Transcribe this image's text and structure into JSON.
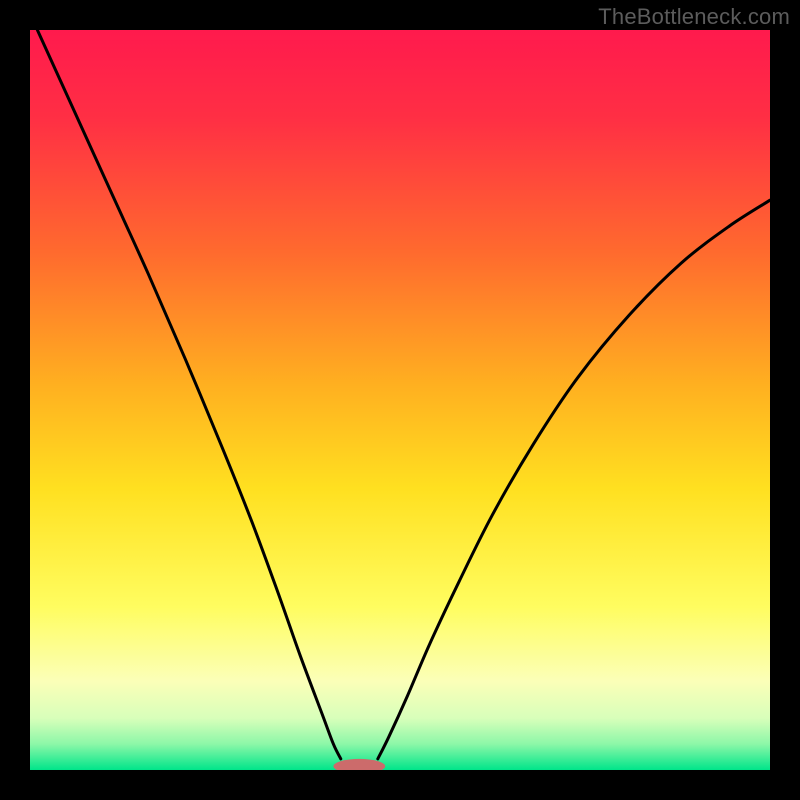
{
  "watermark": "TheBottleneck.com",
  "chart_data": {
    "type": "line",
    "title": "",
    "xlabel": "",
    "ylabel": "",
    "xlim": [
      0,
      1
    ],
    "ylim": [
      0,
      1
    ],
    "background_gradient": {
      "stops": [
        {
          "offset": 0.0,
          "color": "#ff1a4d"
        },
        {
          "offset": 0.12,
          "color": "#ff2f44"
        },
        {
          "offset": 0.3,
          "color": "#ff6a2e"
        },
        {
          "offset": 0.48,
          "color": "#ffb020"
        },
        {
          "offset": 0.62,
          "color": "#ffe020"
        },
        {
          "offset": 0.78,
          "color": "#fffd60"
        },
        {
          "offset": 0.88,
          "color": "#fbffb8"
        },
        {
          "offset": 0.93,
          "color": "#d8ffba"
        },
        {
          "offset": 0.965,
          "color": "#8cf7a8"
        },
        {
          "offset": 1.0,
          "color": "#00e58a"
        }
      ]
    },
    "series": [
      {
        "name": "left-curve",
        "x": [
          0.01,
          0.06,
          0.11,
          0.16,
          0.21,
          0.26,
          0.3,
          0.335,
          0.365,
          0.395,
          0.41,
          0.42
        ],
        "y": [
          1.0,
          0.89,
          0.78,
          0.67,
          0.555,
          0.435,
          0.335,
          0.24,
          0.155,
          0.075,
          0.035,
          0.015
        ]
      },
      {
        "name": "right-curve",
        "x": [
          0.47,
          0.485,
          0.51,
          0.54,
          0.58,
          0.625,
          0.68,
          0.74,
          0.81,
          0.88,
          0.945,
          1.0
        ],
        "y": [
          0.015,
          0.045,
          0.1,
          0.17,
          0.255,
          0.345,
          0.44,
          0.53,
          0.615,
          0.685,
          0.735,
          0.77
        ]
      }
    ],
    "marker": {
      "name": "bottom-marker",
      "cx": 0.445,
      "cy": 0.005,
      "rx": 0.035,
      "ry": 0.01,
      "fill": "#cc6b6b"
    }
  }
}
